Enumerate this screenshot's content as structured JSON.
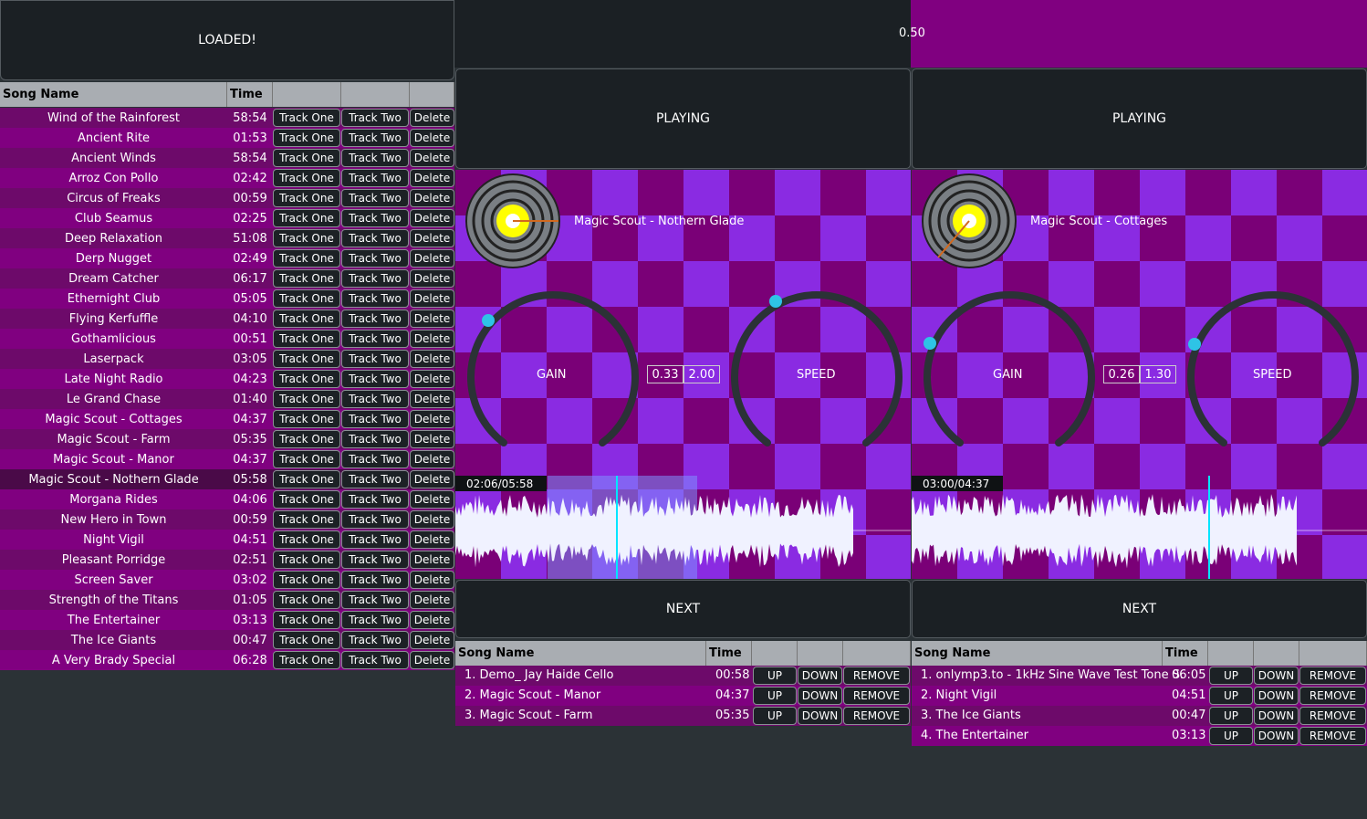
{
  "library": {
    "loaded_label": "LOADED!",
    "headers": {
      "name": "Song Name",
      "time": "Time"
    },
    "buttons": {
      "one": "Track One",
      "two": "Track Two",
      "del": "Delete"
    },
    "songs": [
      {
        "name": "Wind of the Rainforest",
        "time": "58:54"
      },
      {
        "name": "Ancient Rite",
        "time": "01:53"
      },
      {
        "name": "Ancient Winds",
        "time": "58:54"
      },
      {
        "name": "Arroz Con Pollo",
        "time": "02:42"
      },
      {
        "name": "Circus of Freaks",
        "time": "00:59"
      },
      {
        "name": "Club Seamus",
        "time": "02:25"
      },
      {
        "name": "Deep Relaxation",
        "time": "51:08"
      },
      {
        "name": "Derp Nugget",
        "time": "02:49"
      },
      {
        "name": "Dream Catcher",
        "time": "06:17"
      },
      {
        "name": "Ethernight Club",
        "time": "05:05"
      },
      {
        "name": "Flying Kerfuffle",
        "time": "04:10"
      },
      {
        "name": "Gothamlicious",
        "time": "00:51"
      },
      {
        "name": "Laserpack",
        "time": "03:05"
      },
      {
        "name": "Late Night Radio",
        "time": "04:23"
      },
      {
        "name": "Le Grand Chase",
        "time": "01:40"
      },
      {
        "name": "Magic Scout - Cottages",
        "time": "04:37"
      },
      {
        "name": "Magic Scout - Farm",
        "time": "05:35"
      },
      {
        "name": "Magic Scout - Manor",
        "time": "04:37"
      },
      {
        "name": "Magic Scout - Nothern Glade",
        "time": "05:58"
      },
      {
        "name": "Morgana Rides",
        "time": "04:06"
      },
      {
        "name": "New Hero in Town",
        "time": "00:59"
      },
      {
        "name": "Night Vigil",
        "time": "04:51"
      },
      {
        "name": "Pleasant Porridge",
        "time": "02:51"
      },
      {
        "name": "Screen Saver",
        "time": "03:02"
      },
      {
        "name": "Strength of the Titans",
        "time": "01:05"
      },
      {
        "name": "The Entertainer",
        "time": "03:13"
      },
      {
        "name": "The Ice Giants",
        "time": "00:47"
      },
      {
        "name": "A Very Brady Special",
        "time": "06:28"
      }
    ]
  },
  "crossfader": {
    "value": "0.50",
    "position": 0.5
  },
  "deck1": {
    "status": "PLAYING",
    "track": "Magic Scout - Nothern Glade",
    "gain": "0.33",
    "speed": "2.00",
    "gain_label": "GAIN",
    "speed_label": "SPEED",
    "time": "02:06/05:58",
    "next": "NEXT",
    "queue_headers": {
      "name": "Song Name",
      "time": "Time"
    },
    "queue_buttons": {
      "up": "UP",
      "down": "DOWN",
      "remove": "REMOVE"
    },
    "queue": [
      {
        "name": "1. Demo_ Jay Haide Cello",
        "time": "00:58"
      },
      {
        "name": "2. Magic Scout - Manor",
        "time": "04:37"
      },
      {
        "name": "3. Magic Scout - Farm",
        "time": "05:35"
      }
    ]
  },
  "deck2": {
    "status": "PLAYING",
    "track": "Magic Scout - Cottages",
    "gain": "0.26",
    "speed": "1.30",
    "gain_label": "GAIN",
    "speed_label": "SPEED",
    "time": "03:00/04:37",
    "next": "NEXT",
    "queue_headers": {
      "name": "Song Name",
      "time": "Time"
    },
    "queue_buttons": {
      "up": "UP",
      "down": "DOWN",
      "remove": "REMOVE"
    },
    "queue": [
      {
        "name": "1. onlymp3.to - 1kHz Sine Wave Test Tone S.",
        "time": "06:05"
      },
      {
        "name": "2. Night Vigil",
        "time": "04:51"
      },
      {
        "name": "3. The Ice Giants",
        "time": "00:47"
      },
      {
        "name": "4. The Entertainer",
        "time": "03:13"
      }
    ]
  },
  "colors": {
    "accent": "#2ec4e6",
    "row_a": "#6d0a6a",
    "row_b": "#800080",
    "selected": "#4a0a48",
    "checker_light": "#8a2be2",
    "checker_dark": "#7a0077"
  }
}
